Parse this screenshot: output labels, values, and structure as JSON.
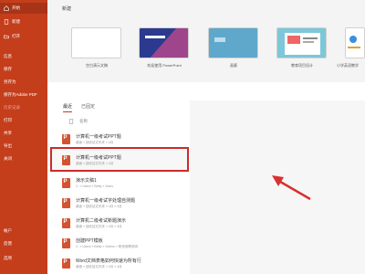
{
  "sidebar": {
    "items": [
      {
        "label": "开始",
        "icon": "home-icon"
      },
      {
        "label": "新建",
        "icon": "new-file-icon"
      },
      {
        "label": "打开",
        "icon": "folder-open-icon"
      },
      {
        "label": "信息"
      },
      {
        "label": "保存"
      },
      {
        "label": "另存为"
      },
      {
        "label": "保存为Adobe PDF"
      },
      {
        "label": "历史记录"
      },
      {
        "label": "打印"
      },
      {
        "label": "共享"
      },
      {
        "label": "导出"
      },
      {
        "label": "关闭"
      },
      {
        "label": "帐户"
      },
      {
        "label": "反馈"
      },
      {
        "label": "选项"
      }
    ]
  },
  "new_section": {
    "title": "新建",
    "templates": [
      {
        "label": "空白演示文稿"
      },
      {
        "label": "欢迎使用 PowerPoint"
      },
      {
        "label": "画廊"
      },
      {
        "label": "教育项目设计"
      },
      {
        "label": "小学英语教学"
      }
    ]
  },
  "recent_tabs": {
    "recent": "最近",
    "pinned": "已固定"
  },
  "list_header": {
    "name_col": "名称"
  },
  "files": [
    {
      "title": "计算机一级考试PPT题",
      "path": "桌面 » 回收站文件夹 » 4月"
    },
    {
      "title": "计算机一级考试PPT题",
      "path": "桌面 » 回收站文件夹 » 4月"
    },
    {
      "title": "演示文稿1",
      "path": "C: » Users » Betty » Video"
    },
    {
      "title": "计算机一级考试字处理自测题",
      "path": "桌面 » 回收站文件夹 » 4月 » 4月"
    },
    {
      "title": "计算机二级考试新题演示",
      "path": "桌面 » 回收站文件夹 » 4月 » 4月"
    },
    {
      "title": "创建PPT模板",
      "path": "C: » Users » Betty » Videos » 职场竞聘说明"
    },
    {
      "title": "Word文档表格如何快速为所有行",
      "path": "桌面 » 回收站文件夹 » 4月 » 4月"
    }
  ],
  "colors": {
    "accent": "#c43e1c",
    "highlight_border": "#cc2a2a"
  }
}
